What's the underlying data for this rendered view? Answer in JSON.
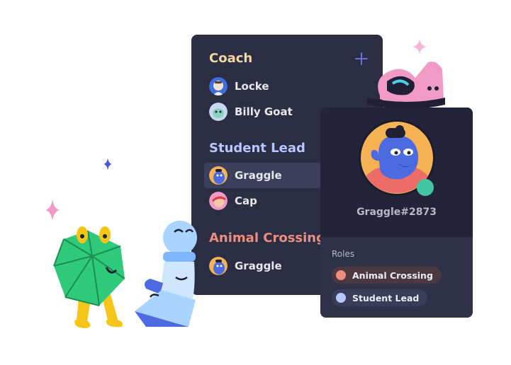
{
  "member_list": {
    "groups": [
      {
        "role": "Coach",
        "color": "#f4d8a2",
        "members": [
          {
            "name": "Locke"
          },
          {
            "name": "Billy Goat"
          }
        ]
      },
      {
        "role": "Student Lead",
        "color": "#b7c7ff",
        "members": [
          {
            "name": "Graggle",
            "selected": true
          },
          {
            "name": "Cap"
          }
        ]
      },
      {
        "role": "Animal Crossing",
        "color": "#ec8d7f",
        "members": [
          {
            "name": "Graggle"
          }
        ]
      }
    ]
  },
  "profile": {
    "username": "Graggle#2873",
    "roles_label": "Roles",
    "roles": [
      {
        "name": "Animal Crossing",
        "color": "#ec8d7f"
      },
      {
        "name": "Student Lead",
        "color": "#b7c7ff"
      }
    ]
  },
  "colors": {
    "panel_bg": "#2b2d42",
    "accent": "#6a6fe0",
    "online": "#43c7a0"
  }
}
